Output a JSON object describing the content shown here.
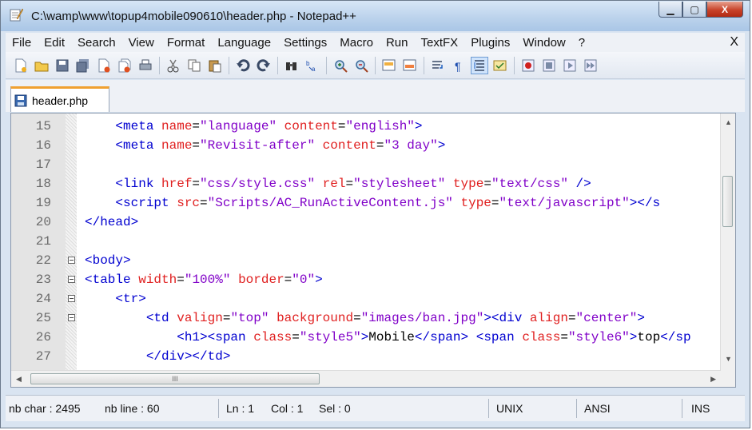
{
  "window": {
    "title": "C:\\wamp\\www\\topup4mobile090610\\header.php - Notepad++",
    "minimize_label": "▁",
    "maximize_label": "▢",
    "close_label": "X"
  },
  "menu": {
    "items": [
      "File",
      "Edit",
      "Search",
      "View",
      "Format",
      "Language",
      "Settings",
      "Macro",
      "Run",
      "TextFX",
      "Plugins",
      "Window",
      "?"
    ],
    "close_label": "X"
  },
  "toolbar": {
    "icons": [
      "new-file-icon",
      "open-file-icon",
      "save-icon",
      "save-all-icon",
      "close-icon",
      "close-all-icon",
      "print-icon",
      "cut-icon",
      "copy-icon",
      "paste-icon",
      "undo-icon",
      "redo-icon",
      "find-icon",
      "replace-icon",
      "zoom-in-icon",
      "zoom-out-icon",
      "sync-vertical-icon",
      "sync-horizontal-icon",
      "wrap-icon",
      "show-all-chars-icon",
      "indent-guide-icon",
      "user-lang-icon",
      "record-macro-icon",
      "stop-macro-icon",
      "play-macro-icon",
      "run-macro-multiple-icon"
    ]
  },
  "tab": {
    "label": "header.php"
  },
  "editor": {
    "lines": [
      {
        "n": "15",
        "code": [
          [
            "t",
            "    <meta "
          ],
          [
            "a",
            "name"
          ],
          [
            "x",
            "="
          ],
          [
            "v",
            "\"language\""
          ],
          [
            "x",
            " "
          ],
          [
            "a",
            "content"
          ],
          [
            "x",
            "="
          ],
          [
            "v",
            "\"english\""
          ],
          [
            "t",
            ">"
          ]
        ]
      },
      {
        "n": "16",
        "code": [
          [
            "t",
            "    <meta "
          ],
          [
            "a",
            "name"
          ],
          [
            "x",
            "="
          ],
          [
            "v",
            "\"Revisit-after\""
          ],
          [
            "x",
            " "
          ],
          [
            "a",
            "content"
          ],
          [
            "x",
            "="
          ],
          [
            "v",
            "\"3 day\""
          ],
          [
            "t",
            ">"
          ]
        ]
      },
      {
        "n": "17",
        "code": []
      },
      {
        "n": "18",
        "code": [
          [
            "t",
            "    <link "
          ],
          [
            "a",
            "href"
          ],
          [
            "x",
            "="
          ],
          [
            "v",
            "\"css/style.css\""
          ],
          [
            "x",
            " "
          ],
          [
            "a",
            "rel"
          ],
          [
            "x",
            "="
          ],
          [
            "v",
            "\"stylesheet\""
          ],
          [
            "x",
            " "
          ],
          [
            "a",
            "type"
          ],
          [
            "x",
            "="
          ],
          [
            "v",
            "\"text/css\""
          ],
          [
            "t",
            " />"
          ]
        ]
      },
      {
        "n": "19",
        "code": [
          [
            "t",
            "    <script "
          ],
          [
            "a",
            "src"
          ],
          [
            "x",
            "="
          ],
          [
            "v",
            "\"Scripts/AC_RunActiveContent.js\""
          ],
          [
            "x",
            " "
          ],
          [
            "a",
            "type"
          ],
          [
            "x",
            "="
          ],
          [
            "v",
            "\"text/javascript\""
          ],
          [
            "t",
            "></s"
          ]
        ]
      },
      {
        "n": "20",
        "code": [
          [
            "t",
            "</head>"
          ]
        ]
      },
      {
        "n": "21",
        "code": []
      },
      {
        "n": "22",
        "code": [
          [
            "t",
            "<body>"
          ]
        ]
      },
      {
        "n": "23",
        "code": [
          [
            "t",
            "<table "
          ],
          [
            "a",
            "width"
          ],
          [
            "x",
            "="
          ],
          [
            "v",
            "\"100%\""
          ],
          [
            "x",
            " "
          ],
          [
            "a",
            "border"
          ],
          [
            "x",
            "="
          ],
          [
            "v",
            "\"0\""
          ],
          [
            "t",
            ">"
          ]
        ]
      },
      {
        "n": "24",
        "code": [
          [
            "t",
            "    <tr>"
          ]
        ]
      },
      {
        "n": "25",
        "code": [
          [
            "t",
            "        <td "
          ],
          [
            "a",
            "valign"
          ],
          [
            "x",
            "="
          ],
          [
            "v",
            "\"top\""
          ],
          [
            "x",
            " "
          ],
          [
            "a",
            "background"
          ],
          [
            "x",
            "="
          ],
          [
            "v",
            "\"images/ban.jpg\""
          ],
          [
            "t",
            "><div "
          ],
          [
            "a",
            "align"
          ],
          [
            "x",
            "="
          ],
          [
            "v",
            "\"center\""
          ],
          [
            "t",
            ">"
          ]
        ]
      },
      {
        "n": "26",
        "code": [
          [
            "t",
            "            <h1><span "
          ],
          [
            "a",
            "class"
          ],
          [
            "x",
            "="
          ],
          [
            "v",
            "\"style5\""
          ],
          [
            "t",
            ">"
          ],
          [
            "x",
            "Mobile"
          ],
          [
            "t",
            "</span>"
          ],
          [
            "x",
            " "
          ],
          [
            "t",
            "<span "
          ],
          [
            "a",
            "class"
          ],
          [
            "x",
            "="
          ],
          [
            "v",
            "\"style6\""
          ],
          [
            "t",
            ">"
          ],
          [
            "x",
            "top"
          ],
          [
            "t",
            "</sp"
          ]
        ]
      },
      {
        "n": "27",
        "code": [
          [
            "t",
            "        </div></td>"
          ]
        ]
      }
    ],
    "hscroll_grip": "III"
  },
  "status": {
    "chars": "nb char : 2495",
    "lines": "nb line : 60",
    "ln": "Ln : 1",
    "col": "Col : 1",
    "sel": "Sel : 0",
    "eol": "UNIX",
    "encoding": "ANSI",
    "mode": "INS"
  }
}
